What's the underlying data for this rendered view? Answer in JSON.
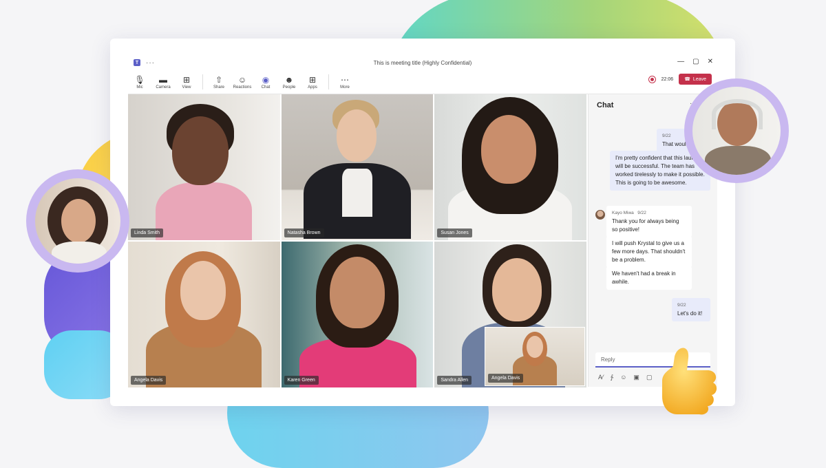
{
  "window": {
    "title": "This is meeting title (Highly Confidential)",
    "controls": [
      "—",
      "▢",
      "✕"
    ]
  },
  "toolbar": {
    "items": [
      {
        "label": "Mic",
        "icon": "mic-icon"
      },
      {
        "label": "Camera",
        "icon": "camera-icon"
      },
      {
        "label": "View",
        "icon": "grid-icon"
      },
      {
        "label": "Share",
        "icon": "share-icon"
      },
      {
        "label": "Reactions",
        "icon": "reactions-icon"
      },
      {
        "label": "Chat",
        "icon": "chat-icon"
      },
      {
        "label": "People",
        "icon": "people-icon"
      },
      {
        "label": "Apps",
        "icon": "apps-icon"
      },
      {
        "label": "More",
        "icon": "more-icon"
      }
    ],
    "timer": "22:06",
    "leave_label": "Leave"
  },
  "participants": [
    {
      "name": "Linda Smith"
    },
    {
      "name": "Natasha Brown"
    },
    {
      "name": "Susan Jones"
    },
    {
      "name": "Angela Davis"
    },
    {
      "name": "Karen Green"
    },
    {
      "name": "Sandra Allen"
    }
  ],
  "pip": {
    "name": "Angela Davis"
  },
  "chat": {
    "title": "Chat",
    "messages": [
      {
        "from": "me",
        "time": "9/22",
        "text": "That would be n"
      },
      {
        "from": "me",
        "time": "",
        "text": "I'm pretty confident that this launch will be successful. The team has worked tirelessly to make it possible. This is going to be awesome."
      },
      {
        "from": "Kayo Miwa",
        "time": "9/22",
        "text": "Thank you for always being so positive!"
      },
      {
        "from": "Kayo Miwa",
        "time": "",
        "text": "I will push Krystal to give us a few more days. That shouldn't be a problem."
      },
      {
        "from": "Kayo Miwa",
        "time": "",
        "text": "We haven't had a break in awhile."
      },
      {
        "from": "me",
        "time": "9/22",
        "text": "Let's do it!"
      }
    ],
    "reply_placeholder": "Reply"
  },
  "colors": {
    "accent": "#5b5fc7",
    "leave": "#c4314b"
  }
}
